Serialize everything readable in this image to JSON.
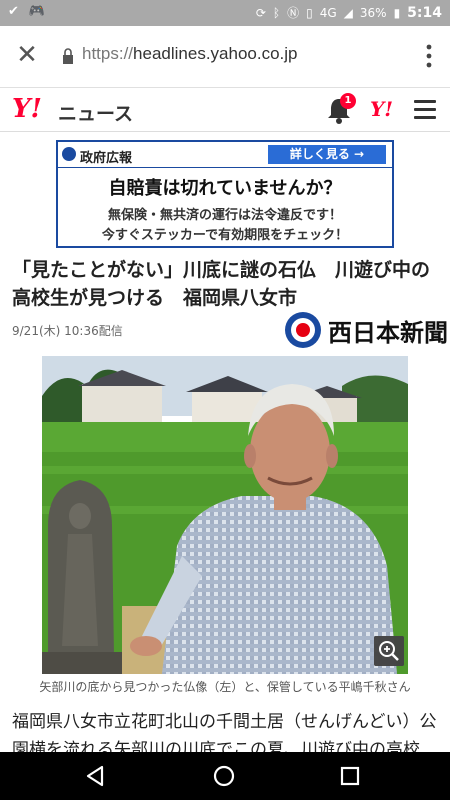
{
  "status_bar": {
    "battery": "36%",
    "network": "4G",
    "time": "5:14"
  },
  "browser": {
    "url_scheme": "https://",
    "url_host": "headlines.yahoo.co.jp"
  },
  "header": {
    "logo": "Y!",
    "section": "ニュース",
    "notification_count": "1",
    "ymark": "Y!"
  },
  "ad": {
    "org": "政府広報",
    "button": "詳しく見る →",
    "title": "自賠責は切れていませんか？",
    "line1": "無保険・無共済の運行は法令違反です！",
    "line2": "今すぐステッカーで有効期限をチェック！"
  },
  "article": {
    "headline": "「見たことがない」川底に謎の石仏　川遊び中の高校生が見つける　福岡県八女市",
    "date": "9/21(木) 10:36配信",
    "publisher": "西日本新聞",
    "caption": "矢部川の底から見つかった仏像（左）と、保管している平嶋千秋さん",
    "body": "福岡県八女市立花町北山の千間土居（せんげんどい）公園横を流れる矢部川の川底でこの夏、川遊び中の高校"
  },
  "colors": {
    "yahoo_red": "#ff0033",
    "ad_blue": "#1a4aa0",
    "status_gray": "#a9a9a9"
  }
}
